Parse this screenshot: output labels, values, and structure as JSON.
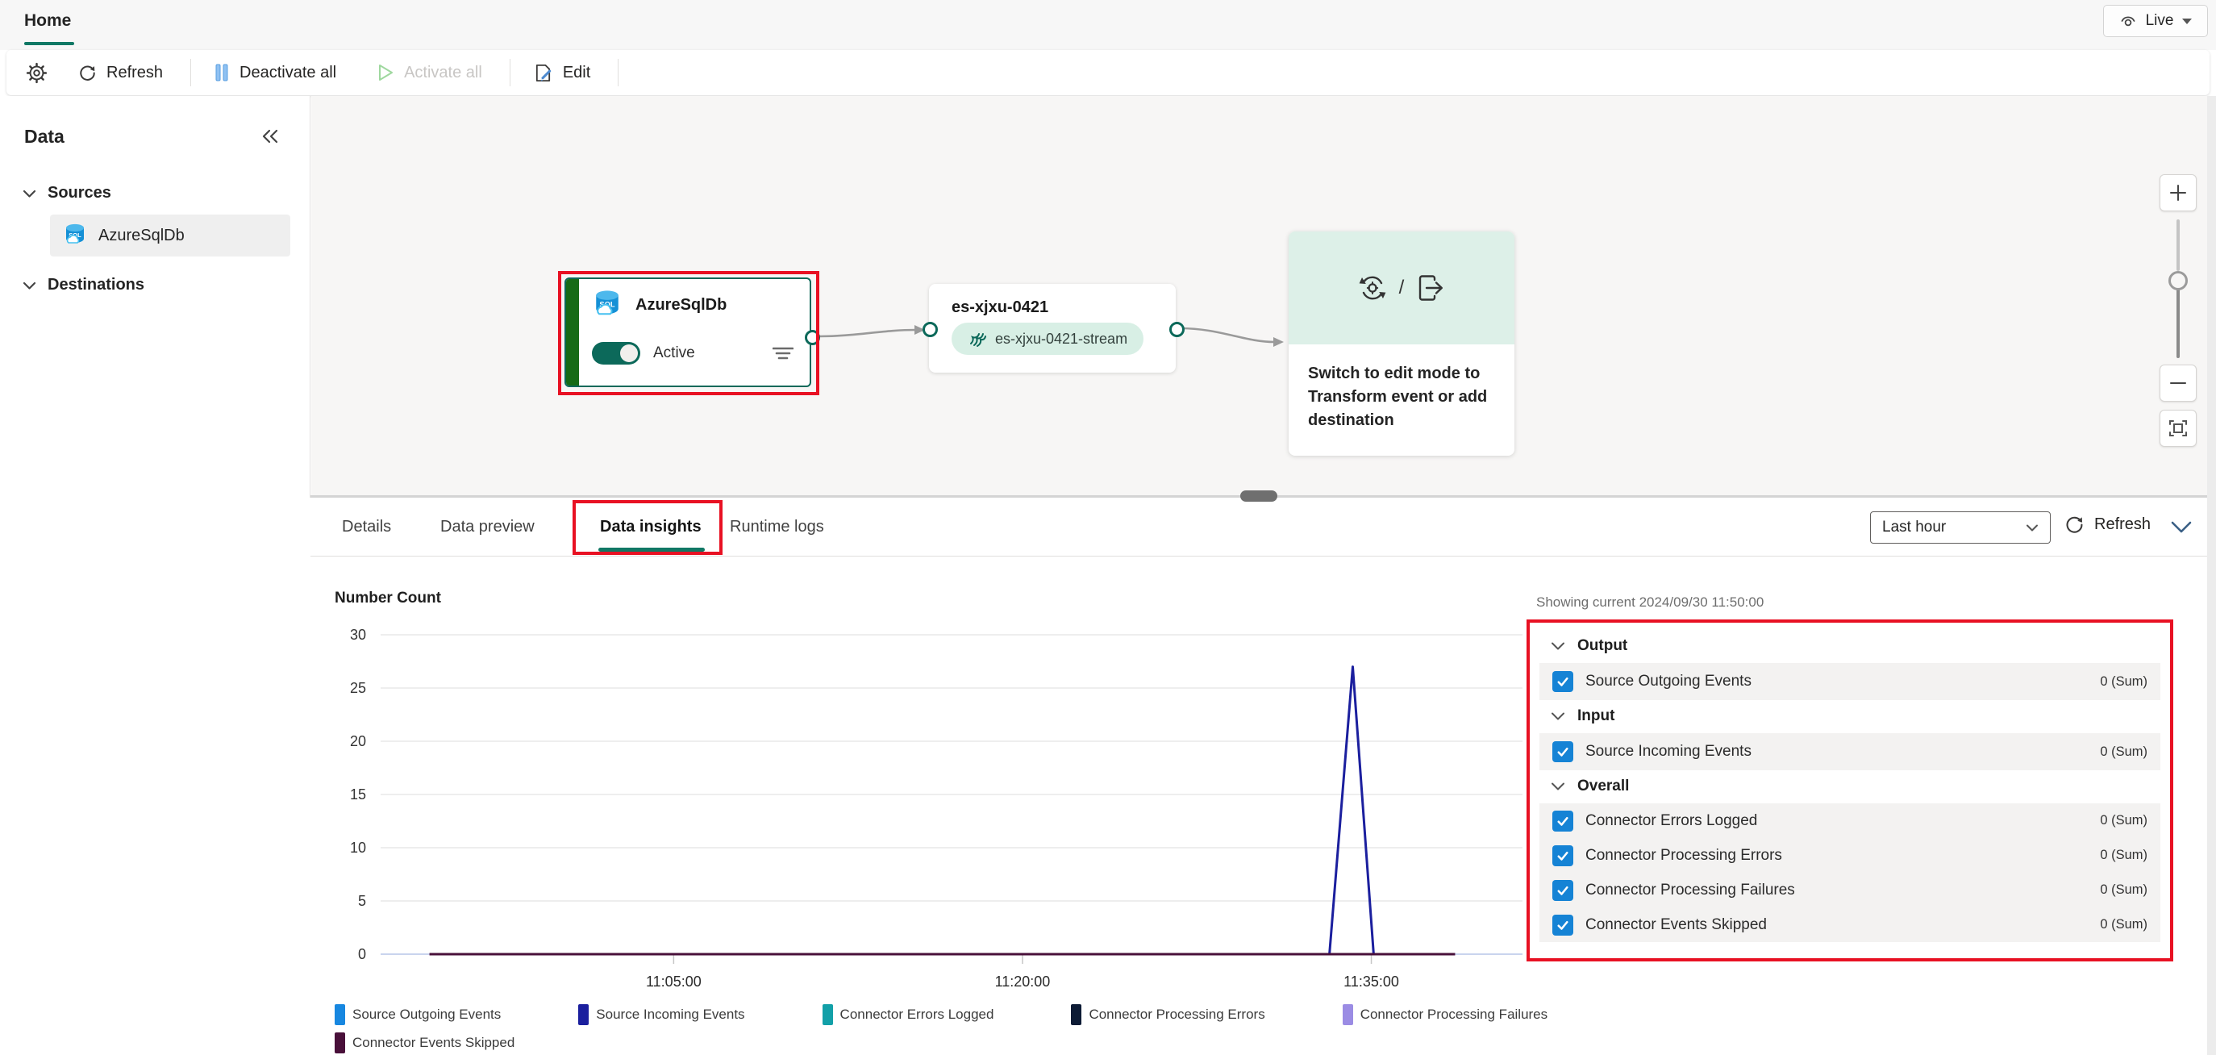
{
  "header": {
    "tab_label": "Home",
    "live_label": "Live"
  },
  "toolbar": {
    "refresh_label": "Refresh",
    "deactivate_all_label": "Deactivate all",
    "activate_all_label": "Activate all",
    "edit_label": "Edit"
  },
  "sidebar": {
    "title": "Data",
    "sources_label": "Sources",
    "source_item_label": "AzureSqlDb",
    "destinations_label": "Destinations"
  },
  "canvas": {
    "source_node": {
      "title": "AzureSqlDb",
      "status_label": "Active"
    },
    "stream_node": {
      "title": "es-xjxu-0421",
      "stream_label": "es-xjxu-0421-stream"
    },
    "placeholder_node": {
      "message": "Switch to edit mode to Transform event or add destination",
      "separator": "/"
    }
  },
  "bottom_panel": {
    "tabs": [
      {
        "label": "Details"
      },
      {
        "label": "Data preview"
      },
      {
        "label": "Data insights"
      },
      {
        "label": "Runtime logs"
      }
    ],
    "active_tab": "Data insights",
    "time_range_value": "Last hour",
    "refresh_label": "Refresh"
  },
  "metrics_panel": {
    "showing_label": "Showing current 2024/09/30 11:50:00",
    "sections": [
      {
        "label": "Output",
        "rows": [
          {
            "label": "Source Outgoing Events",
            "value": "0 (Sum)",
            "checked": true
          }
        ]
      },
      {
        "label": "Input",
        "rows": [
          {
            "label": "Source Incoming Events",
            "value": "0 (Sum)",
            "checked": true
          }
        ]
      },
      {
        "label": "Overall",
        "rows": [
          {
            "label": "Connector Errors Logged",
            "value": "0 (Sum)",
            "checked": true
          },
          {
            "label": "Connector Processing Errors",
            "value": "0 (Sum)",
            "checked": true
          },
          {
            "label": "Connector Processing Failures",
            "value": "0 (Sum)",
            "checked": true
          },
          {
            "label": "Connector Events Skipped",
            "value": "0 (Sum)",
            "checked": true
          }
        ]
      }
    ]
  },
  "chart_data": {
    "type": "line",
    "title": "Number Count",
    "xlabel": "",
    "ylabel": "",
    "ylim": [
      0,
      30
    ],
    "y_ticks": [
      30,
      25,
      20,
      15,
      10,
      5,
      0
    ],
    "x_domain_minutes": [
      652.4,
      701.5
    ],
    "x_ticks": [
      {
        "minute": 665,
        "label": "11:05:00"
      },
      {
        "minute": 680,
        "label": "11:20:00"
      },
      {
        "minute": 695,
        "label": "11:35:00"
      }
    ],
    "grid": true,
    "legend_position": "bottom",
    "series": [
      {
        "name": "Source Outgoing Events",
        "color": "#1787e0",
        "points": [
          [
            654.5,
            0
          ],
          [
            698.6,
            0
          ]
        ]
      },
      {
        "name": "Source Incoming Events",
        "color": "#1b1f9e",
        "points": [
          [
            654.5,
            0
          ],
          [
            693.2,
            0
          ],
          [
            694.2,
            27
          ],
          [
            695.1,
            0
          ],
          [
            698.6,
            0
          ]
        ]
      },
      {
        "name": "Connector Errors Logged",
        "color": "#12a0a8",
        "points": [
          [
            654.5,
            0
          ],
          [
            698.6,
            0
          ]
        ]
      },
      {
        "name": "Connector Processing Errors",
        "color": "#0d1b35",
        "points": [
          [
            654.5,
            0
          ],
          [
            698.6,
            0
          ]
        ]
      },
      {
        "name": "Connector Processing Failures",
        "color": "#9b8ce4",
        "points": [
          [
            654.5,
            0
          ],
          [
            698.6,
            0
          ]
        ]
      },
      {
        "name": "Connector Events Skipped",
        "color": "#49103a",
        "points": [
          [
            654.5,
            0
          ],
          [
            698.6,
            0
          ]
        ]
      }
    ]
  },
  "colors": {
    "accent_teal": "#117865",
    "node_teal": "#0c695a",
    "node_stripe_green": "#166b16",
    "annotation_red": "#e81123",
    "checkbox_blue": "#1583d5",
    "canvas_bg": "#f7f6f5",
    "row_gray": "#f3f2f1"
  }
}
